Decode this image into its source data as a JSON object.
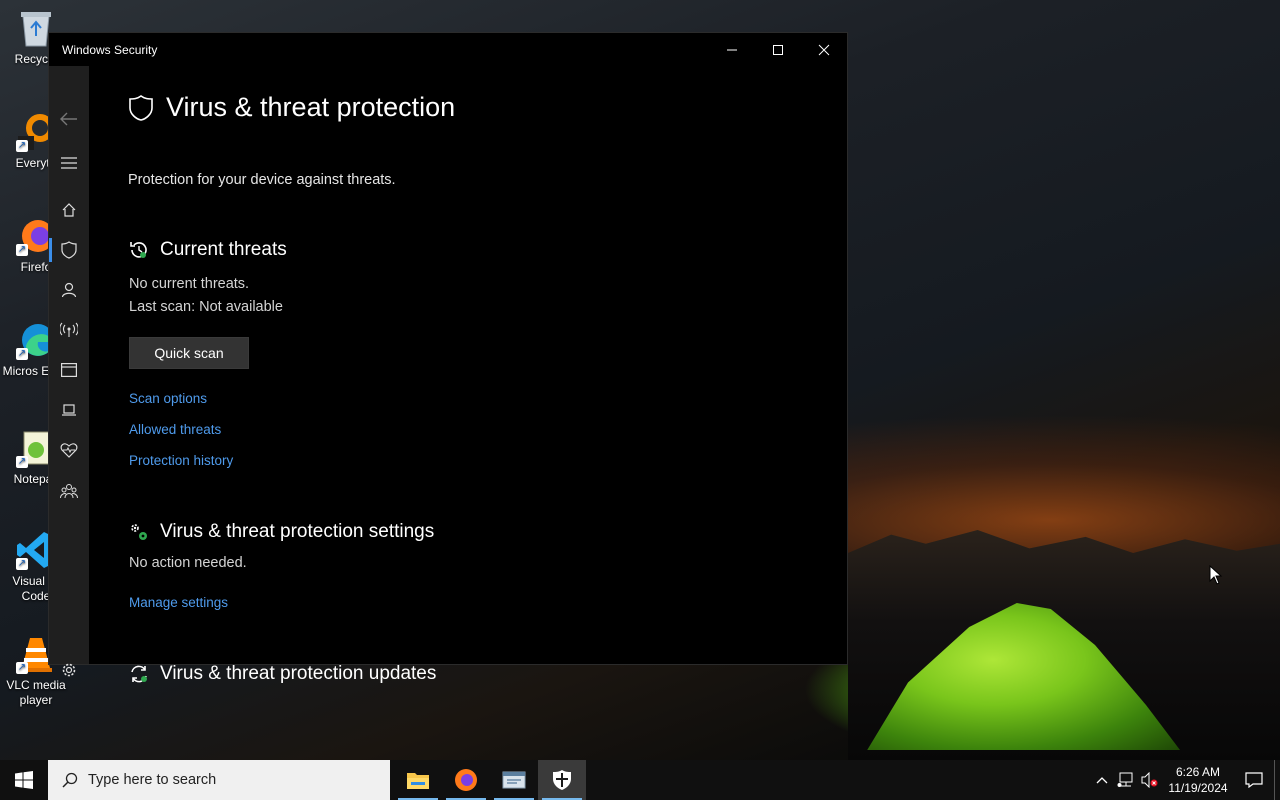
{
  "desktop": {
    "icons": [
      {
        "label": "Recycle"
      },
      {
        "label": "Everyth"
      },
      {
        "label": "Firefo"
      },
      {
        "label": "Micros Edge"
      },
      {
        "label": "Notepac"
      },
      {
        "label": "Visual St Code"
      },
      {
        "label": "VLC media player"
      }
    ]
  },
  "window": {
    "title": "Windows Security",
    "page_title": "Virus & threat protection",
    "subtitle": "Protection for your device against threats.",
    "current_threats": {
      "heading": "Current threats",
      "status": "No current threats.",
      "last_scan": "Last scan: Not available",
      "quick_scan": "Quick scan",
      "links": [
        "Scan options",
        "Allowed threats",
        "Protection history"
      ]
    },
    "settings": {
      "heading": "Virus & threat protection settings",
      "status": "No action needed.",
      "link": "Manage settings"
    },
    "updates": {
      "heading": "Virus & threat protection updates"
    }
  },
  "taskbar": {
    "search_placeholder": "Type here to search",
    "time": "6:26 AM",
    "date": "11/19/2024"
  },
  "colors": {
    "link": "#4f9bec",
    "accent": "#3b8eea"
  }
}
